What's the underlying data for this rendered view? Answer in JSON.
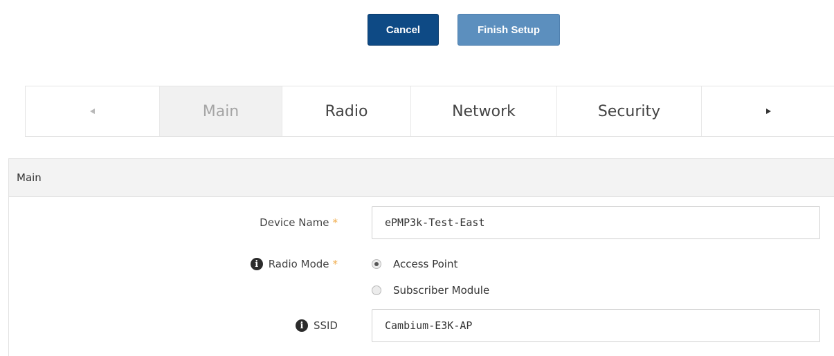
{
  "actions": {
    "cancel_label": "Cancel",
    "finish_label": "Finish Setup"
  },
  "tabs": {
    "prev_icon": "caret-left-icon",
    "next_icon": "caret-right-icon",
    "items": [
      {
        "label": "Main",
        "active": true
      },
      {
        "label": "Radio",
        "active": false
      },
      {
        "label": "Network",
        "active": false
      },
      {
        "label": "Security",
        "active": false
      }
    ]
  },
  "section": {
    "title": "Main",
    "device_name": {
      "label": "Device Name",
      "required_mark": "*",
      "value": "ePMP3k-Test-East"
    },
    "radio_mode": {
      "label": "Radio Mode",
      "required_mark": "*",
      "info_icon": "info-icon",
      "options": [
        {
          "label": "Access Point",
          "selected": true
        },
        {
          "label": "Subscriber Module",
          "selected": false
        }
      ]
    },
    "ssid": {
      "label": "SSID",
      "info_icon": "info-icon",
      "value": "Cambium-E3K-AP"
    }
  },
  "colors": {
    "cancel_button": "#0e4a85",
    "finish_button": "#5c8fbe",
    "required_mark": "#f0ad4e",
    "active_tab_bg": "#f1f1f1"
  }
}
